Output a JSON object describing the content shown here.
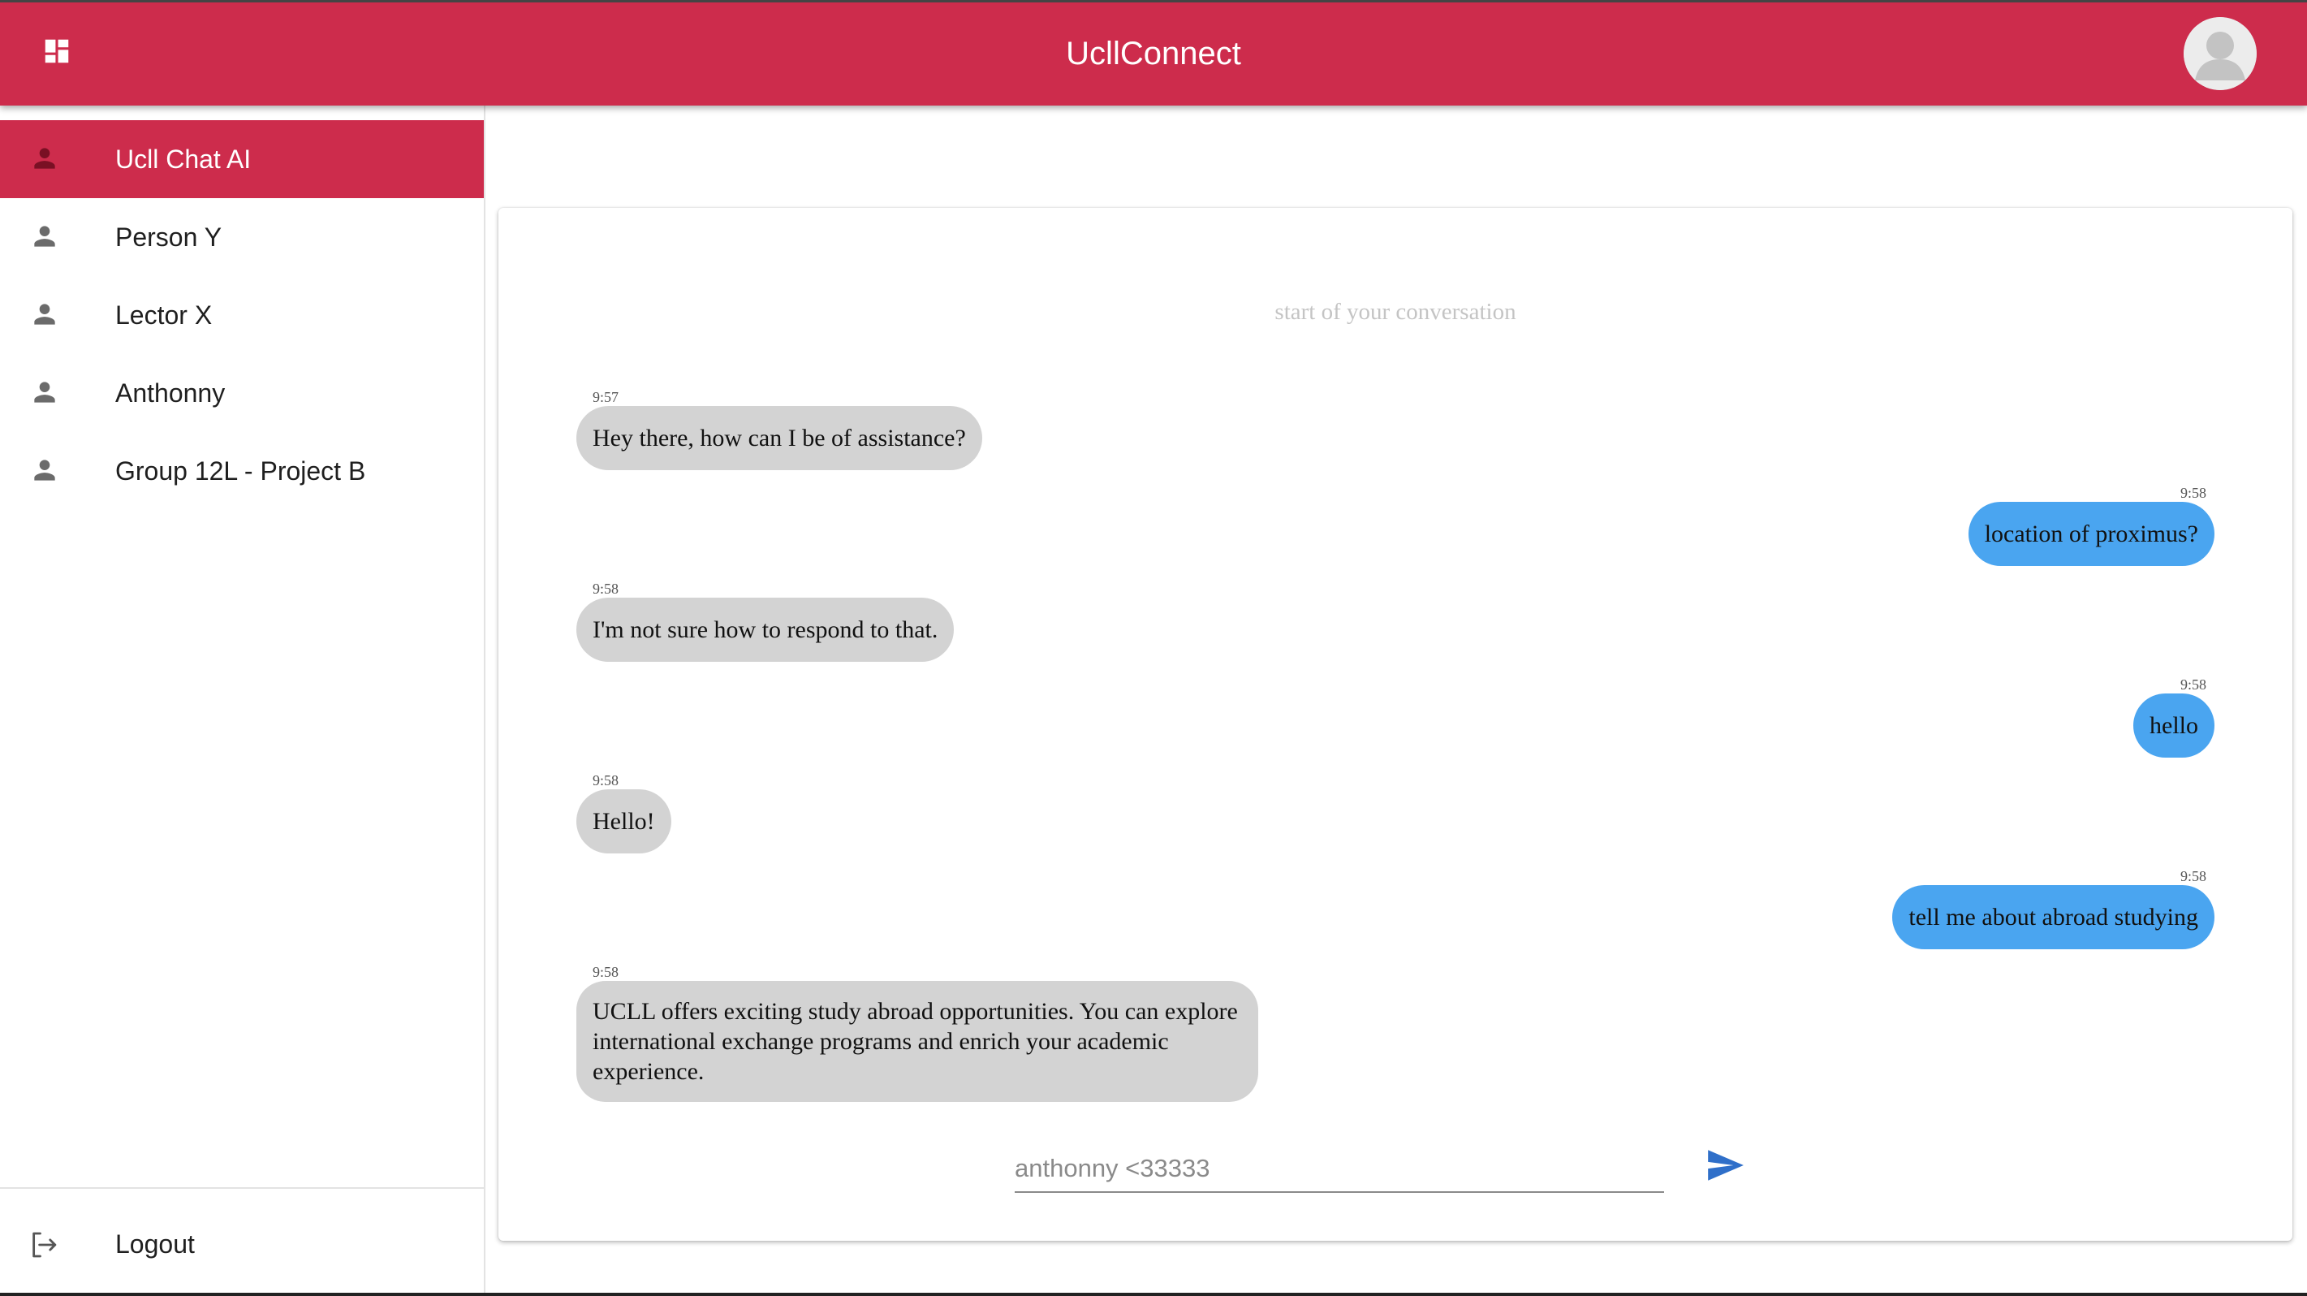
{
  "header": {
    "title": "UcllConnect",
    "menu_icon": "dashboard-icon",
    "avatar_icon": "user-avatar-icon",
    "brand_color": "#cd2c4c"
  },
  "sidebar": {
    "items": [
      {
        "label": "Ucll Chat AI",
        "icon": "person-icon",
        "active": true
      },
      {
        "label": "Person Y",
        "icon": "person-icon",
        "active": false
      },
      {
        "label": "Lector X",
        "icon": "person-icon",
        "active": false
      },
      {
        "label": "Anthonny",
        "icon": "person-icon",
        "active": false
      },
      {
        "label": "Group 12L - Project B",
        "icon": "person-icon",
        "active": false
      }
    ],
    "logout": {
      "label": "Logout",
      "icon": "logout-icon"
    }
  },
  "chat": {
    "start_text": "start of your conversation",
    "messages": [
      {
        "from": "received",
        "time": "9:57",
        "text": "Hey there, how can I be of assistance?"
      },
      {
        "from": "sent",
        "time": "9:58",
        "text": "location of proximus?"
      },
      {
        "from": "received",
        "time": "9:58",
        "text": "I'm not sure how to respond to that."
      },
      {
        "from": "sent",
        "time": "9:58",
        "text": "hello"
      },
      {
        "from": "received",
        "time": "9:58",
        "text": "Hello!"
      },
      {
        "from": "sent",
        "time": "9:58",
        "text": "tell me about abroad studying"
      },
      {
        "from": "received",
        "time": "9:58",
        "text": "UCLL offers exciting study abroad opportunities. You can explore international exchange programs and enrich your academic experience."
      }
    ],
    "input": {
      "value": "",
      "placeholder": "anthonny <33333"
    },
    "send_icon": "send-icon",
    "received_color": "#d3d3d3",
    "sent_color": "#4aa5f0"
  }
}
